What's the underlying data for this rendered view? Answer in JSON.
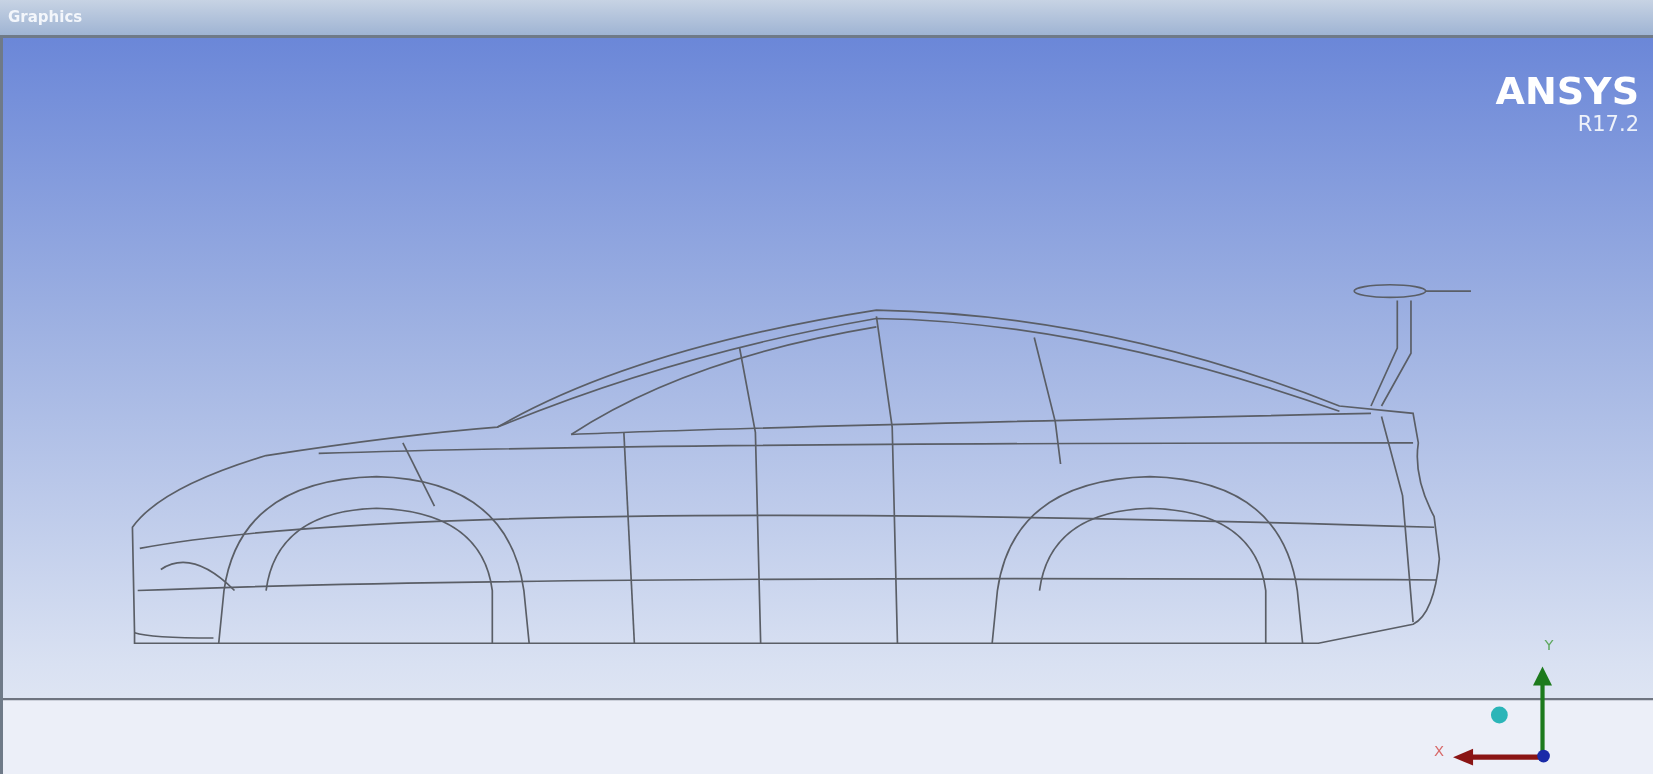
{
  "window": {
    "title": "Graphics"
  },
  "logo": {
    "name": "ANSYS",
    "version": "R17.2"
  },
  "triad": {
    "x_label": "X",
    "y_label": "Y"
  }
}
